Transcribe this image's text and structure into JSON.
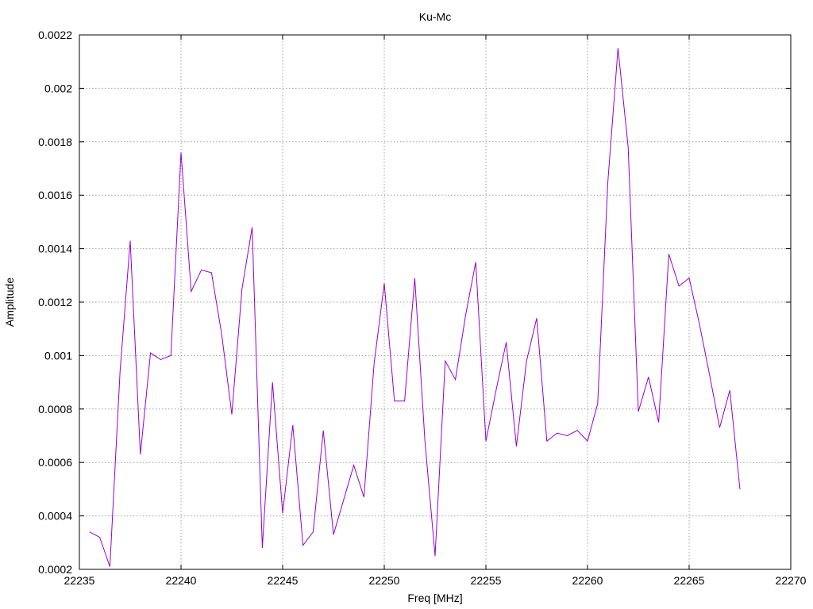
{
  "chart_data": {
    "type": "line",
    "title": "Ku-Mc",
    "xlabel": "Freq [MHz]",
    "ylabel": "Amplitude",
    "xlim": [
      22235,
      22270
    ],
    "ylim": [
      0.0002,
      0.0022
    ],
    "grid": true,
    "x_ticks": [
      "22235",
      "22240",
      "22245",
      "22250",
      "22255",
      "22260",
      "22265",
      "22270"
    ],
    "y_ticks": [
      "0.0002",
      "0.0004",
      "0.0006",
      "0.0008",
      "0.001",
      "0.0012",
      "0.0014",
      "0.0016",
      "0.0018",
      "0.002",
      "0.0022"
    ],
    "series": [
      {
        "color": "#9400d3",
        "x": [
          22235.5,
          22236.0,
          22236.5,
          22237.0,
          22237.5,
          22238.0,
          22238.5,
          22239.0,
          22239.5,
          22240.0,
          22240.5,
          22241.0,
          22241.5,
          22242.0,
          22242.5,
          22243.0,
          22243.5,
          22244.0,
          22244.5,
          22245.0,
          22245.5,
          22246.0,
          22246.5,
          22247.0,
          22247.5,
          22248.0,
          22248.5,
          22249.0,
          22249.5,
          22250.0,
          22250.5,
          22251.0,
          22251.5,
          22252.0,
          22252.5,
          22253.0,
          22253.5,
          22254.0,
          22254.5,
          22255.0,
          22255.5,
          22256.0,
          22256.5,
          22257.0,
          22257.5,
          22258.0,
          22258.5,
          22259.0,
          22259.5,
          22260.0,
          22260.5,
          22261.0,
          22261.5,
          22262.0,
          22262.5,
          22263.0,
          22263.5,
          22264.0,
          22264.5,
          22265.0,
          22265.5,
          22266.0,
          22266.5,
          22267.0,
          22267.5
        ],
        "y": [
          0.00034,
          0.00032,
          0.00021,
          0.00094,
          0.00143,
          0.00063,
          0.00101,
          0.000985,
          0.001,
          0.00176,
          0.00124,
          0.00132,
          0.00131,
          0.00108,
          0.00078,
          0.00125,
          0.00148,
          0.00028,
          0.0009,
          0.00041,
          0.00074,
          0.00029,
          0.00034,
          0.00072,
          0.00033,
          0.00046,
          0.00059,
          0.00047,
          0.00097,
          0.00127,
          0.00083,
          0.00083,
          0.00129,
          0.00068,
          0.00025,
          0.00098,
          0.00091,
          0.00115,
          0.00135,
          0.00068,
          0.00087,
          0.00105,
          0.00066,
          0.00098,
          0.00114,
          0.00068,
          0.00071,
          0.0007,
          0.00072,
          0.00068,
          0.00082,
          0.00165,
          0.00215,
          0.00178,
          0.00079,
          0.00092,
          0.00075,
          0.00138,
          0.00126,
          0.00129,
          0.00112,
          0.00093,
          0.00073,
          0.00087,
          0.0005
        ]
      }
    ]
  }
}
